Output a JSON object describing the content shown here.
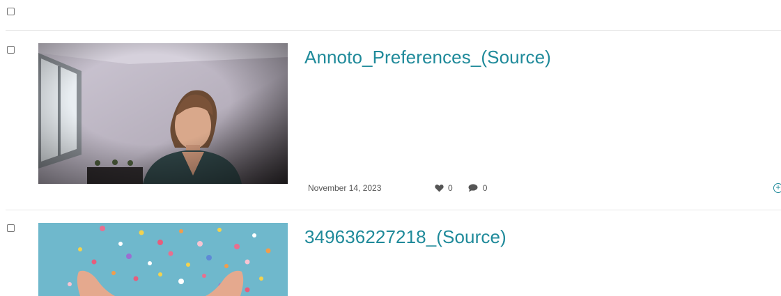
{
  "entries": [
    {
      "title": "Annoto_Preferences_(Source)",
      "date": "November 14, 2023",
      "likes": "0",
      "comments": "0"
    },
    {
      "title": "349636227218_(Source)"
    }
  ],
  "colors": {
    "link": "#1f8a9a",
    "divider": "#e6e6e6"
  },
  "icons": [
    "heart-icon",
    "comment-icon",
    "add-circle-icon"
  ]
}
